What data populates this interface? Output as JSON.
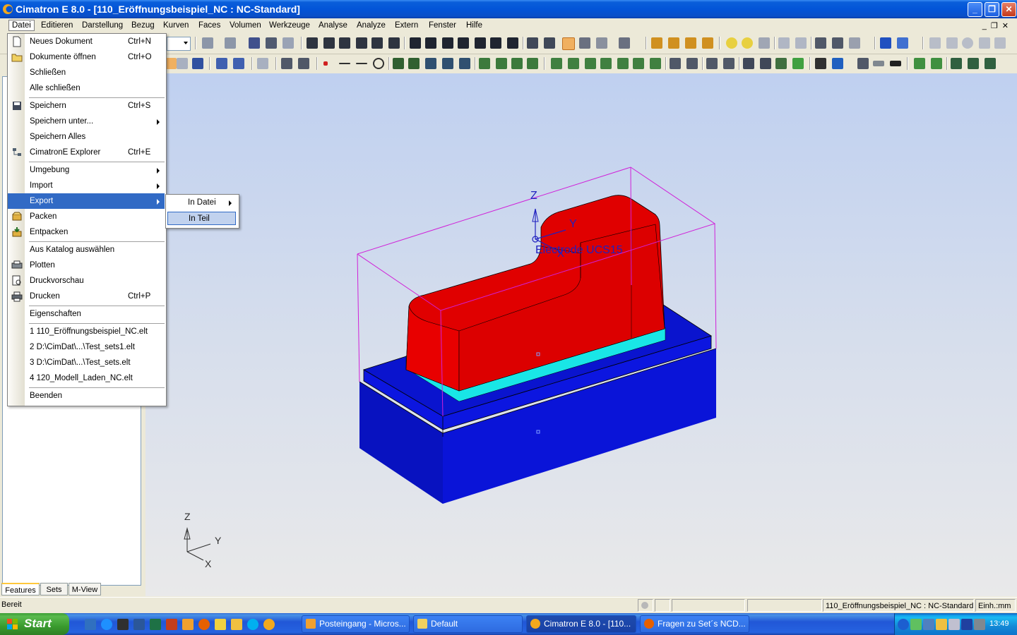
{
  "window": {
    "title": "Cimatron E 8.0 - [110_Eröffnungsbeispiel_NC : NC-Standard]"
  },
  "menubar": {
    "items": [
      "Datei",
      "Editieren",
      "Darstellung",
      "Bezug",
      "Kurven",
      "Faces",
      "Volumen",
      "Werkzeuge",
      "Analyse",
      "Analyze",
      "Extern",
      "Fenster",
      "Hilfe"
    ],
    "active": "Datei"
  },
  "datei_menu": {
    "items": [
      {
        "label": "Neues Dokument",
        "shortcut": "Ctrl+N",
        "icon": "new-document-icon"
      },
      {
        "label": "Dokumente öffnen",
        "shortcut": "Ctrl+O",
        "icon": "open-folder-icon"
      },
      {
        "label": "Schließen",
        "shortcut": ""
      },
      {
        "label": "Alle schließen",
        "shortcut": ""
      },
      {
        "label": "Speichern",
        "shortcut": "Ctrl+S",
        "icon": "save-icon"
      },
      {
        "label": "Speichern unter...",
        "shortcut": "",
        "submenu": true
      },
      {
        "label": "Speichern Alles",
        "shortcut": ""
      },
      {
        "label": "CimatronE Explorer",
        "shortcut": "Ctrl+E",
        "icon": "explorer-tree-icon"
      },
      {
        "label": "Umgebung",
        "shortcut": "",
        "submenu": true
      },
      {
        "label": "Import",
        "shortcut": "",
        "submenu": true
      },
      {
        "label": "Export",
        "shortcut": "",
        "submenu": true,
        "highlighted": true
      },
      {
        "label": "Packen",
        "shortcut": "",
        "icon": "pack-icon"
      },
      {
        "label": "Entpacken",
        "shortcut": "",
        "icon": "unpack-icon"
      },
      {
        "label": "Aus Katalog auswählen",
        "shortcut": ""
      },
      {
        "label": "Plotten",
        "shortcut": "",
        "icon": "plotter-icon"
      },
      {
        "label": "Druckvorschau",
        "shortcut": "",
        "icon": "print-preview-icon"
      },
      {
        "label": "Drucken",
        "shortcut": "Ctrl+P",
        "icon": "printer-icon"
      },
      {
        "label": "Eigenschaften",
        "shortcut": ""
      },
      {
        "label": "1 110_Eröffnungsbeispiel_NC.elt",
        "shortcut": ""
      },
      {
        "label": "2 D:\\CimDat\\...\\Test_sets1.elt",
        "shortcut": ""
      },
      {
        "label": "3 D:\\CimDat\\...\\Test_sets.elt",
        "shortcut": ""
      },
      {
        "label": "4 120_Modell_Laden_NC.elt",
        "shortcut": ""
      },
      {
        "label": "Beenden",
        "shortcut": ""
      }
    ]
  },
  "export_submenu": {
    "items": [
      {
        "label": "In Datei",
        "submenu": true
      },
      {
        "label": "In Teil",
        "selected": true
      }
    ]
  },
  "viewport": {
    "ucs_label": "Electrode UCS15",
    "axis_z": "Z",
    "axis_y": "Y",
    "axis_x": "X",
    "colors": {
      "part": "#E00000",
      "base": "#0A14D8",
      "band": "#19E6E6",
      "bbox": "#D020D8"
    }
  },
  "leftpanel": {
    "tabs": [
      "Features",
      "Sets",
      "M-View"
    ],
    "selected_tab": "Features"
  },
  "statusbar": {
    "status": "Bereit",
    "document": "110_Eröffnungsbeispiel_NC : NC-Standard",
    "units": "Einh.:mm"
  },
  "taskbar": {
    "start_label": "Start",
    "tasks": [
      {
        "label": "Posteingang - Micros...",
        "icon": "outlook-icon"
      },
      {
        "label": "Default",
        "icon": "folder-icon"
      },
      {
        "label": "Cimatron E 8.0 - [110...",
        "icon": "cimatron-icon",
        "active": true
      },
      {
        "label": "Fragen zu Set´s NCD...",
        "icon": "firefox-icon"
      }
    ],
    "clock": "13:49"
  }
}
